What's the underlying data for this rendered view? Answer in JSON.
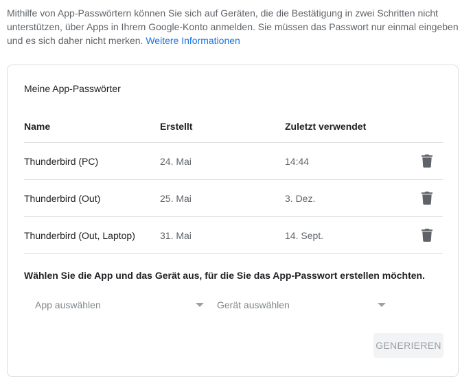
{
  "intro": {
    "text": "Mithilfe von App-Passwörtern können Sie sich auf Geräten, die die Bestätigung in zwei Schritten nicht unterstützen, über Apps in Ihrem Google-Konto anmelden. Sie müssen das Passwort nur einmal eingeben und es sich daher nicht merken.",
    "link_label": "Weitere Informationen",
    "link_color": "#1a73e8"
  },
  "card": {
    "title": "Meine App-Passwörter",
    "columns": {
      "name": "Name",
      "created": "Erstellt",
      "last_used": "Zuletzt verwendet"
    },
    "rows": [
      {
        "name": "Thunderbird (PC)",
        "created": "24. Mai",
        "last_used": "14:44",
        "delete_icon": "trash-icon"
      },
      {
        "name": "Thunderbird (Out)",
        "created": "25. Mai",
        "last_used": "3. Dez.",
        "delete_icon": "trash-icon"
      },
      {
        "name": "Thunderbird (Out, Laptop)",
        "created": "31. Mai",
        "last_used": "14. Sept.",
        "delete_icon": "trash-icon"
      }
    ],
    "select_prompt": "Wählen Sie die App und das Gerät aus, für die Sie das App-Passwort erstellen möchten.",
    "app_select": {
      "placeholder": "App auswählen",
      "icon": "dropdown-arrow-icon"
    },
    "device_select": {
      "placeholder": "Gerät auswählen",
      "icon": "dropdown-arrow-icon"
    },
    "generate_label": "GENERIEREN",
    "generate_disabled": true
  }
}
